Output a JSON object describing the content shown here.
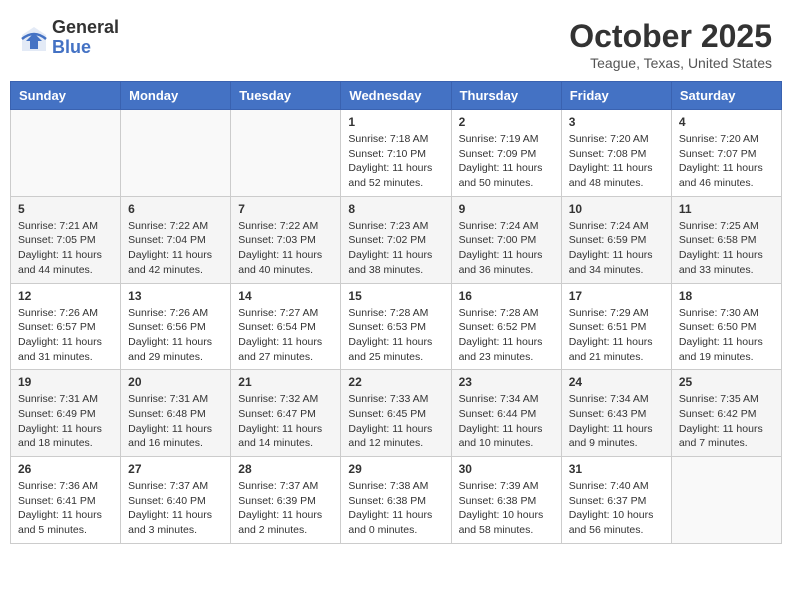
{
  "header": {
    "logo_general": "General",
    "logo_blue": "Blue",
    "month": "October 2025",
    "location": "Teague, Texas, United States"
  },
  "weekdays": [
    "Sunday",
    "Monday",
    "Tuesday",
    "Wednesday",
    "Thursday",
    "Friday",
    "Saturday"
  ],
  "weeks": [
    [
      {
        "day": "",
        "content": ""
      },
      {
        "day": "",
        "content": ""
      },
      {
        "day": "",
        "content": ""
      },
      {
        "day": "1",
        "content": "Sunrise: 7:18 AM\nSunset: 7:10 PM\nDaylight: 11 hours\nand 52 minutes."
      },
      {
        "day": "2",
        "content": "Sunrise: 7:19 AM\nSunset: 7:09 PM\nDaylight: 11 hours\nand 50 minutes."
      },
      {
        "day": "3",
        "content": "Sunrise: 7:20 AM\nSunset: 7:08 PM\nDaylight: 11 hours\nand 48 minutes."
      },
      {
        "day": "4",
        "content": "Sunrise: 7:20 AM\nSunset: 7:07 PM\nDaylight: 11 hours\nand 46 minutes."
      }
    ],
    [
      {
        "day": "5",
        "content": "Sunrise: 7:21 AM\nSunset: 7:05 PM\nDaylight: 11 hours\nand 44 minutes."
      },
      {
        "day": "6",
        "content": "Sunrise: 7:22 AM\nSunset: 7:04 PM\nDaylight: 11 hours\nand 42 minutes."
      },
      {
        "day": "7",
        "content": "Sunrise: 7:22 AM\nSunset: 7:03 PM\nDaylight: 11 hours\nand 40 minutes."
      },
      {
        "day": "8",
        "content": "Sunrise: 7:23 AM\nSunset: 7:02 PM\nDaylight: 11 hours\nand 38 minutes."
      },
      {
        "day": "9",
        "content": "Sunrise: 7:24 AM\nSunset: 7:00 PM\nDaylight: 11 hours\nand 36 minutes."
      },
      {
        "day": "10",
        "content": "Sunrise: 7:24 AM\nSunset: 6:59 PM\nDaylight: 11 hours\nand 34 minutes."
      },
      {
        "day": "11",
        "content": "Sunrise: 7:25 AM\nSunset: 6:58 PM\nDaylight: 11 hours\nand 33 minutes."
      }
    ],
    [
      {
        "day": "12",
        "content": "Sunrise: 7:26 AM\nSunset: 6:57 PM\nDaylight: 11 hours\nand 31 minutes."
      },
      {
        "day": "13",
        "content": "Sunrise: 7:26 AM\nSunset: 6:56 PM\nDaylight: 11 hours\nand 29 minutes."
      },
      {
        "day": "14",
        "content": "Sunrise: 7:27 AM\nSunset: 6:54 PM\nDaylight: 11 hours\nand 27 minutes."
      },
      {
        "day": "15",
        "content": "Sunrise: 7:28 AM\nSunset: 6:53 PM\nDaylight: 11 hours\nand 25 minutes."
      },
      {
        "day": "16",
        "content": "Sunrise: 7:28 AM\nSunset: 6:52 PM\nDaylight: 11 hours\nand 23 minutes."
      },
      {
        "day": "17",
        "content": "Sunrise: 7:29 AM\nSunset: 6:51 PM\nDaylight: 11 hours\nand 21 minutes."
      },
      {
        "day": "18",
        "content": "Sunrise: 7:30 AM\nSunset: 6:50 PM\nDaylight: 11 hours\nand 19 minutes."
      }
    ],
    [
      {
        "day": "19",
        "content": "Sunrise: 7:31 AM\nSunset: 6:49 PM\nDaylight: 11 hours\nand 18 minutes."
      },
      {
        "day": "20",
        "content": "Sunrise: 7:31 AM\nSunset: 6:48 PM\nDaylight: 11 hours\nand 16 minutes."
      },
      {
        "day": "21",
        "content": "Sunrise: 7:32 AM\nSunset: 6:47 PM\nDaylight: 11 hours\nand 14 minutes."
      },
      {
        "day": "22",
        "content": "Sunrise: 7:33 AM\nSunset: 6:45 PM\nDaylight: 11 hours\nand 12 minutes."
      },
      {
        "day": "23",
        "content": "Sunrise: 7:34 AM\nSunset: 6:44 PM\nDaylight: 11 hours\nand 10 minutes."
      },
      {
        "day": "24",
        "content": "Sunrise: 7:34 AM\nSunset: 6:43 PM\nDaylight: 11 hours\nand 9 minutes."
      },
      {
        "day": "25",
        "content": "Sunrise: 7:35 AM\nSunset: 6:42 PM\nDaylight: 11 hours\nand 7 minutes."
      }
    ],
    [
      {
        "day": "26",
        "content": "Sunrise: 7:36 AM\nSunset: 6:41 PM\nDaylight: 11 hours\nand 5 minutes."
      },
      {
        "day": "27",
        "content": "Sunrise: 7:37 AM\nSunset: 6:40 PM\nDaylight: 11 hours\nand 3 minutes."
      },
      {
        "day": "28",
        "content": "Sunrise: 7:37 AM\nSunset: 6:39 PM\nDaylight: 11 hours\nand 2 minutes."
      },
      {
        "day": "29",
        "content": "Sunrise: 7:38 AM\nSunset: 6:38 PM\nDaylight: 11 hours\nand 0 minutes."
      },
      {
        "day": "30",
        "content": "Sunrise: 7:39 AM\nSunset: 6:38 PM\nDaylight: 10 hours\nand 58 minutes."
      },
      {
        "day": "31",
        "content": "Sunrise: 7:40 AM\nSunset: 6:37 PM\nDaylight: 10 hours\nand 56 minutes."
      },
      {
        "day": "",
        "content": ""
      }
    ]
  ]
}
